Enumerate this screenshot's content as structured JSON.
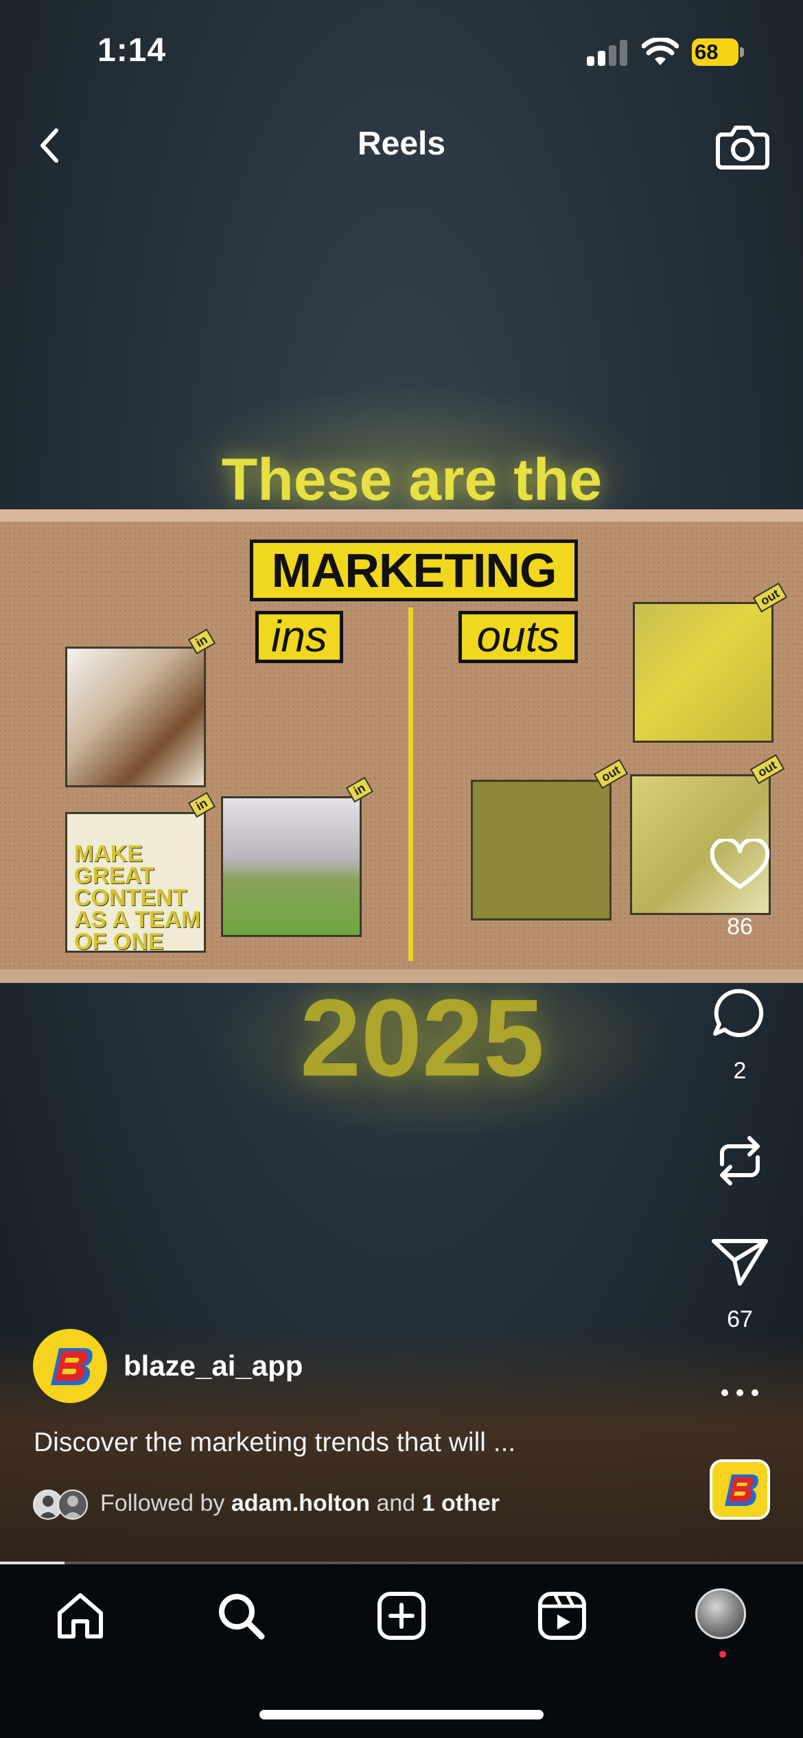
{
  "status_bar": {
    "time": "1:14",
    "battery": "68"
  },
  "header": {
    "title": "Reels"
  },
  "video": {
    "headline_top": "These are the",
    "label_marketing": "MARKETING",
    "label_ins": "ins",
    "label_outs": "outs",
    "headline_bottom": "2025",
    "poster_text": "MAKE GREAT CONTENT AS A TEAM OF ONE",
    "tags": {
      "in": "in",
      "out": "out"
    },
    "progress": 0.08
  },
  "actions": {
    "likes": "86",
    "comments": "2",
    "shares": "67"
  },
  "post": {
    "username": "blaze_ai_app",
    "caption": "Discover the marketing trends that will ...",
    "followed_prefix": "Followed by",
    "followed_user": "adam.holton",
    "followed_and": "and",
    "followed_other": "1 other"
  },
  "colors": {
    "accent_yellow": "#f6d41e",
    "brand_red": "#e0262b",
    "brand_blue": "#1c6fd1"
  }
}
